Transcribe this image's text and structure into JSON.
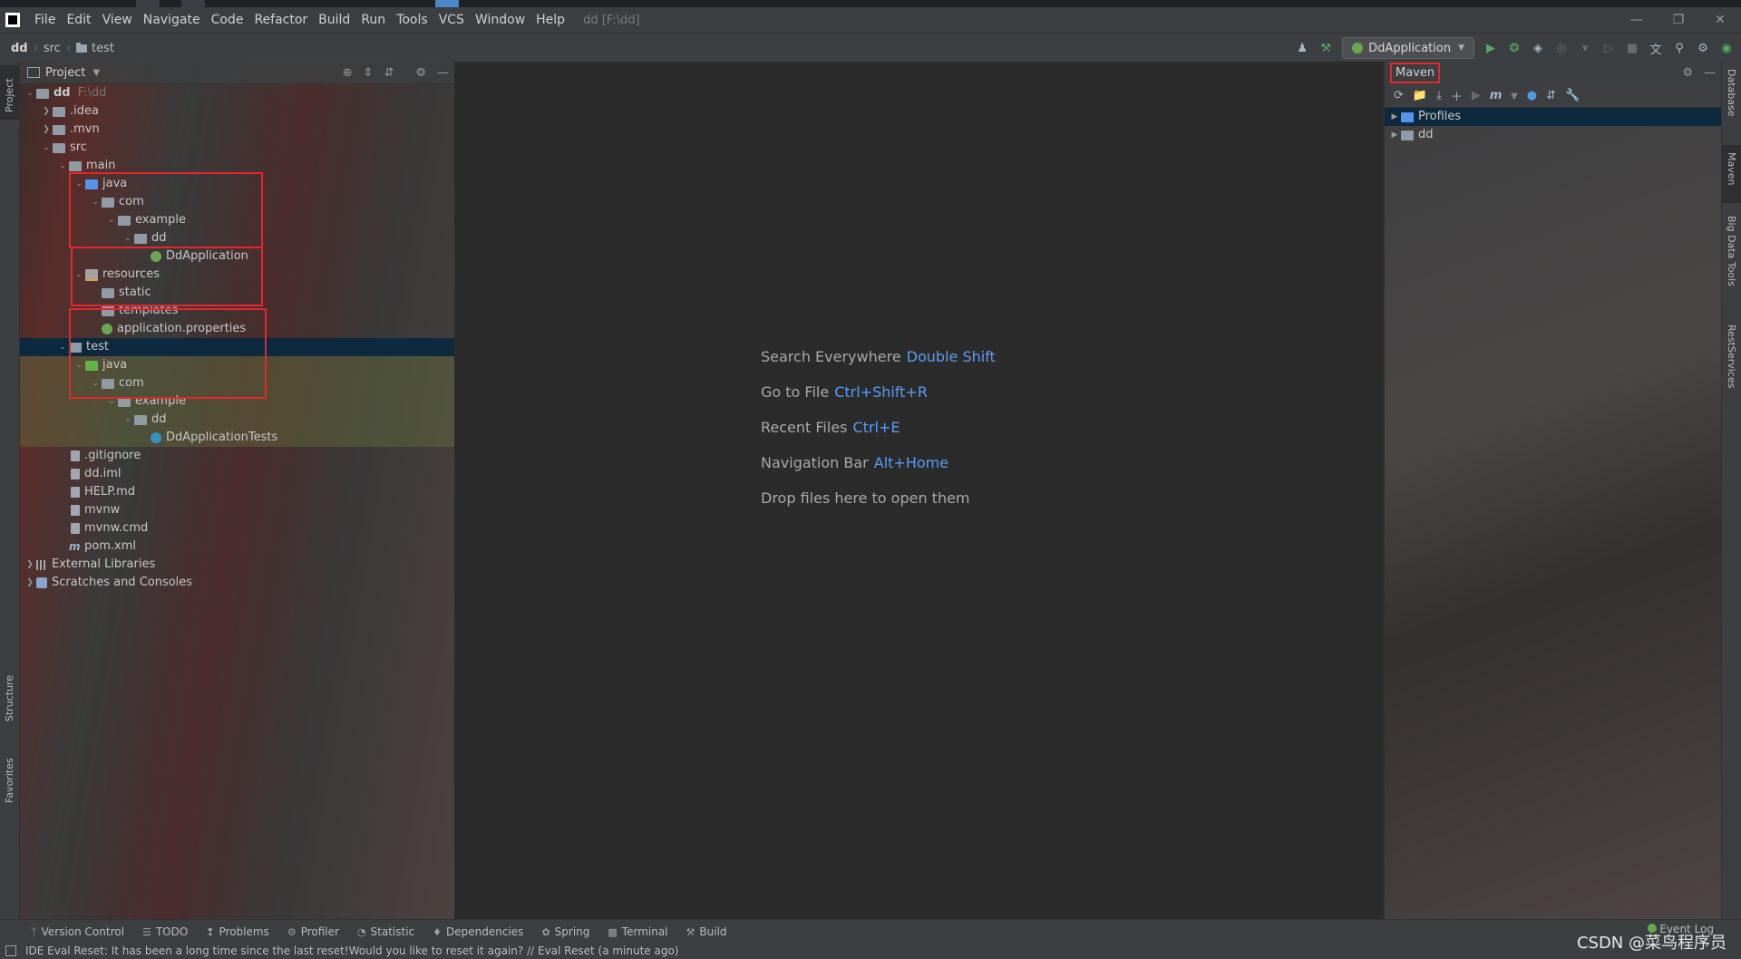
{
  "menubar": {
    "items": [
      "File",
      "Edit",
      "View",
      "Navigate",
      "Code",
      "Refactor",
      "Build",
      "Run",
      "Tools",
      "VCS",
      "Window",
      "Help"
    ],
    "window_title": "dd [F:\\dd]"
  },
  "navbar": {
    "breadcrumb": [
      "dd",
      "src",
      "test"
    ],
    "run_config": "DdApplication"
  },
  "left_stripe": {
    "top_label": "Project",
    "structure_label": "Structure",
    "favorites_label": "Favorites"
  },
  "right_stripe": {
    "database": "Database",
    "maven": "Maven",
    "bigdata": "Big Data Tools",
    "rest": "RestServices"
  },
  "project_panel": {
    "title": "Project",
    "tree": [
      {
        "label": "dd",
        "extra": "F:\\dd",
        "depth": 0,
        "expanded": true,
        "icon": "module-icon",
        "bold": true
      },
      {
        "label": ".idea",
        "depth": 1,
        "expanded": false,
        "icon": "folder-icon"
      },
      {
        "label": ".mvn",
        "depth": 1,
        "expanded": false,
        "icon": "folder-icon"
      },
      {
        "label": "src",
        "depth": 1,
        "expanded": true,
        "icon": "folder-icon"
      },
      {
        "label": "main",
        "depth": 2,
        "expanded": true,
        "icon": "folder-icon"
      },
      {
        "label": "java",
        "depth": 3,
        "expanded": true,
        "icon": "source-folder-icon"
      },
      {
        "label": "com",
        "depth": 4,
        "expanded": true,
        "icon": "package-icon"
      },
      {
        "label": "example",
        "depth": 5,
        "expanded": true,
        "icon": "package-icon"
      },
      {
        "label": "dd",
        "depth": 6,
        "expanded": true,
        "icon": "package-icon"
      },
      {
        "label": "DdApplication",
        "depth": 7,
        "leaf": true,
        "icon": "spring-class-icon"
      },
      {
        "label": "resources",
        "depth": 3,
        "expanded": true,
        "icon": "resources-folder-icon"
      },
      {
        "label": "static",
        "depth": 4,
        "leaf": true,
        "icon": "folder-icon"
      },
      {
        "label": "templates",
        "depth": 4,
        "leaf": true,
        "icon": "folder-icon"
      },
      {
        "label": "application.properties",
        "depth": 4,
        "leaf": true,
        "icon": "spring-properties-icon"
      },
      {
        "label": "test",
        "depth": 2,
        "expanded": true,
        "icon": "folder-icon",
        "selected": true
      },
      {
        "label": "java",
        "depth": 3,
        "expanded": true,
        "icon": "test-folder-icon",
        "tested": true
      },
      {
        "label": "com",
        "depth": 4,
        "expanded": true,
        "icon": "package-icon",
        "tested": true
      },
      {
        "label": "example",
        "depth": 5,
        "expanded": true,
        "icon": "package-icon",
        "tested": true
      },
      {
        "label": "dd",
        "depth": 6,
        "expanded": true,
        "icon": "package-icon",
        "tested": true
      },
      {
        "label": "DdApplicationTests",
        "depth": 7,
        "leaf": true,
        "icon": "class-icon",
        "tested": true
      },
      {
        "label": ".gitignore",
        "depth": 2,
        "leaf": true,
        "icon": "file-icon"
      },
      {
        "label": "dd.iml",
        "depth": 2,
        "leaf": true,
        "icon": "file-icon"
      },
      {
        "label": "HELP.md",
        "depth": 2,
        "leaf": true,
        "icon": "file-icon"
      },
      {
        "label": "mvnw",
        "depth": 2,
        "leaf": true,
        "icon": "file-icon"
      },
      {
        "label": "mvnw.cmd",
        "depth": 2,
        "leaf": true,
        "icon": "file-icon"
      },
      {
        "label": "pom.xml",
        "depth": 2,
        "leaf": true,
        "icon": "maven-file-icon"
      },
      {
        "label": "External Libraries",
        "depth": 0,
        "expanded": false,
        "icon": "library-icon"
      },
      {
        "label": "Scratches and Consoles",
        "depth": 0,
        "expanded": false,
        "icon": "scratch-icon"
      }
    ]
  },
  "editor": {
    "hints": [
      {
        "text": "Search Everywhere",
        "key": "Double Shift"
      },
      {
        "text": "Go to File",
        "key": "Ctrl+Shift+R"
      },
      {
        "text": "Recent Files",
        "key": "Ctrl+E"
      },
      {
        "text": "Navigation Bar",
        "key": "Alt+Home"
      },
      {
        "text": "Drop files here to open them",
        "key": ""
      }
    ]
  },
  "maven": {
    "title": "Maven",
    "items": [
      {
        "label": "Profiles",
        "icon": "profiles-icon",
        "selected": true
      },
      {
        "label": "dd",
        "icon": "maven-module-icon"
      }
    ]
  },
  "bottom_tabs": [
    "Version Control",
    "TODO",
    "Problems",
    "Profiler",
    "Statistic",
    "Dependencies",
    "Spring",
    "Terminal",
    "Build"
  ],
  "event_log": "Event Log",
  "status_text": "IDE Eval Reset: It has been a long time since the last reset!Would you like to reset it again? // Eval Reset (a minute ago)",
  "watermark": "CSDN @菜鸟程序员",
  "colors": {
    "accent": "#589df6",
    "highlight_box": "#e5262a",
    "selection": "#0d293e"
  }
}
